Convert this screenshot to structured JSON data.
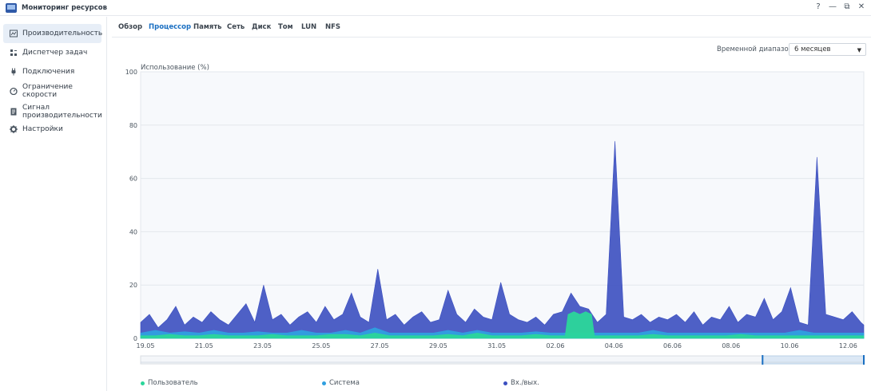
{
  "app": {
    "title": "Мониторинг ресурсов",
    "controls": [
      "?",
      "—",
      "⧉",
      "✕"
    ]
  },
  "sidebar": {
    "items": [
      {
        "label": "Производительность",
        "icon": "performance-icon",
        "active": true
      },
      {
        "label": "Диспетчер задач",
        "icon": "task-manager-icon",
        "active": false
      },
      {
        "label": "Подключения",
        "icon": "connections-icon",
        "active": false
      },
      {
        "label": "Ограничение скорости",
        "icon": "speed-limit-icon",
        "active": false
      },
      {
        "label": "Сигнал производительности",
        "icon": "alert-icon",
        "active": false
      },
      {
        "label": "Настройки",
        "icon": "gear-icon",
        "active": false
      }
    ]
  },
  "tabs": [
    {
      "label": "Обзор",
      "active": false
    },
    {
      "label": "Процессор",
      "active": true
    },
    {
      "label": "Память",
      "active": false
    },
    {
      "label": "Сеть",
      "active": false
    },
    {
      "label": "Диск",
      "active": false
    },
    {
      "label": "Том",
      "active": false
    },
    {
      "label": "LUN",
      "active": false
    },
    {
      "label": "NFS",
      "active": false
    }
  ],
  "time_range": {
    "label": "Временной диапазон:",
    "value": "6 месяцев"
  },
  "colors": {
    "accent": "#1a6fc2",
    "user": "#2bd69a",
    "system": "#2f9fe0",
    "io": "#3b4fc0"
  },
  "chart_data": {
    "type": "area",
    "ylabel": "Использование (%)",
    "ylim": [
      0,
      100
    ],
    "yticks": [
      0,
      20,
      40,
      60,
      80,
      100
    ],
    "x_tick_labels": [
      "19.05",
      "21.05",
      "23.05",
      "25.05",
      "27.05",
      "29.05",
      "31.05",
      "02.06",
      "04.06",
      "06.06",
      "08.06",
      "10.06",
      "12.06"
    ],
    "x_range_days": [
      0,
      24.7
    ],
    "grid": true,
    "legend_position": "bottom",
    "series": [
      {
        "name": "Пользователь",
        "color": "#2bd69a",
        "x": [
          0,
          0.5,
          1,
          1.5,
          2,
          2.5,
          3,
          3.5,
          4,
          4.5,
          5,
          5.5,
          6,
          6.5,
          7,
          7.5,
          8,
          8.5,
          9,
          9.5,
          10,
          10.5,
          11,
          11.5,
          12,
          12.5,
          13,
          13.5,
          14,
          14.5,
          14.6,
          14.8,
          15,
          15.2,
          15.4,
          15.5,
          16,
          16.5,
          17,
          17.5,
          18,
          18.5,
          19,
          19.5,
          20,
          20.5,
          21,
          21.5,
          22,
          22.5,
          23,
          23.5,
          24,
          24.5,
          24.7
        ],
        "values": [
          1,
          1,
          1.5,
          1,
          1,
          1.5,
          1,
          1,
          1,
          1.5,
          1,
          1,
          1,
          1.5,
          1.5,
          1,
          2,
          1,
          1,
          1,
          1,
          1.5,
          1,
          2,
          1,
          1,
          1,
          1.5,
          1,
          1,
          9,
          10,
          9,
          10,
          9,
          1,
          1,
          1,
          1,
          1.5,
          1,
          1,
          1,
          1,
          1,
          1.5,
          1,
          1,
          1,
          1,
          1,
          1,
          1,
          1,
          1
        ]
      },
      {
        "name": "Система",
        "color": "#2f9fe0",
        "x": [
          0,
          0.5,
          1,
          1.5,
          2,
          2.5,
          3,
          3.5,
          4,
          4.5,
          5,
          5.5,
          6,
          6.5,
          7,
          7.5,
          8,
          8.5,
          9,
          9.5,
          10,
          10.5,
          11,
          11.5,
          12,
          12.5,
          13,
          13.5,
          14,
          14.5,
          15,
          15.5,
          16,
          16.5,
          17,
          17.5,
          18,
          18.5,
          19,
          19.5,
          20,
          20.5,
          21,
          21.5,
          22,
          22.5,
          23,
          23.5,
          24,
          24.5,
          24.7
        ],
        "values": [
          2,
          3,
          2,
          2.5,
          2,
          3,
          2,
          2,
          2.5,
          2,
          2,
          3,
          2,
          2,
          3,
          2,
          4,
          2,
          2,
          2,
          2,
          3,
          2,
          3,
          2,
          2,
          2,
          2.5,
          2,
          2,
          2,
          2,
          2,
          2,
          2,
          3,
          2,
          2,
          2,
          2,
          2,
          2,
          2,
          2,
          2,
          3,
          2,
          2,
          2,
          2,
          2
        ]
      },
      {
        "name": "Вх./вых.",
        "color": "#3b4fc0",
        "x": [
          0,
          0.3,
          0.6,
          0.9,
          1.2,
          1.5,
          1.8,
          2.1,
          2.4,
          2.7,
          3.0,
          3.3,
          3.6,
          3.9,
          4.2,
          4.5,
          4.8,
          5.1,
          5.4,
          5.7,
          6.0,
          6.3,
          6.6,
          6.9,
          7.2,
          7.5,
          7.8,
          8.1,
          8.4,
          8.7,
          9.0,
          9.3,
          9.6,
          9.9,
          10.2,
          10.5,
          10.8,
          11.1,
          11.4,
          11.7,
          12.0,
          12.3,
          12.6,
          12.9,
          13.2,
          13.5,
          13.8,
          14.1,
          14.4,
          14.7,
          15.0,
          15.3,
          15.6,
          15.9,
          16.2,
          16.5,
          16.8,
          17.1,
          17.4,
          17.7,
          18.0,
          18.3,
          18.6,
          18.9,
          19.2,
          19.5,
          19.8,
          20.1,
          20.4,
          20.7,
          21.0,
          21.3,
          21.6,
          21.9,
          22.2,
          22.5,
          22.8,
          23.1,
          23.4,
          23.7,
          24.0,
          24.3,
          24.6,
          24.7
        ],
        "values": [
          6,
          9,
          4,
          7,
          12,
          5,
          8,
          6,
          10,
          7,
          5,
          9,
          13,
          6,
          20,
          7,
          9,
          5,
          8,
          10,
          6,
          12,
          7,
          9,
          17,
          8,
          6,
          26,
          7,
          9,
          5,
          8,
          10,
          6,
          7,
          18,
          9,
          6,
          11,
          8,
          7,
          21,
          9,
          7,
          6,
          8,
          5,
          9,
          10,
          17,
          12,
          11,
          6,
          9,
          74,
          8,
          7,
          9,
          6,
          8,
          7,
          9,
          6,
          10,
          5,
          8,
          7,
          12,
          6,
          9,
          8,
          15,
          7,
          10,
          19,
          6,
          5,
          68,
          9,
          8,
          7,
          10,
          6,
          5
        ]
      }
    ]
  }
}
